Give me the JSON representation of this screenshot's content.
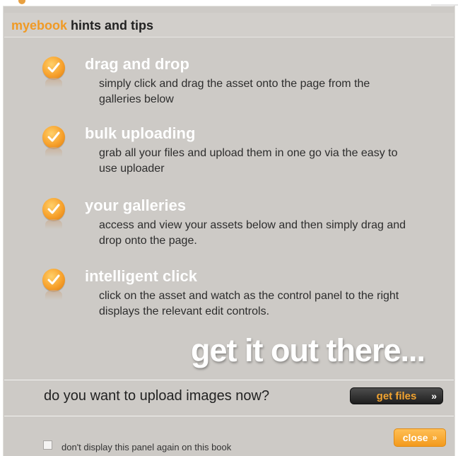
{
  "header": {
    "brand": "myebook",
    "title": " hints and tips"
  },
  "tips": [
    {
      "title": "drag and drop",
      "body": "simply click and drag the asset onto the page from the galleries below"
    },
    {
      "title": "bulk uploading",
      "body": "grab all your files and upload them in one go via the easy to use uploader"
    },
    {
      "title": "your galleries",
      "body": "access and view your assets below and then simply drag and drop onto the page."
    },
    {
      "title": "intelligent click",
      "body": "click on the asset and watch as the control panel to the right displays the relevant edit controls."
    }
  ],
  "slogan": "get it out there...",
  "upload": {
    "question": "do you want to upload images now?",
    "button_label": "get files",
    "button_chevron": "»"
  },
  "footer": {
    "checkbox_label": "don't display this panel again on this book",
    "checked": false,
    "close_label": "close",
    "close_chevron": "»"
  },
  "colors": {
    "accent": "#f09a25",
    "panel": "#cdcac6",
    "dark_button": "#2a2a2a"
  },
  "icons": {
    "tip_icon": "check-circle-icon"
  }
}
